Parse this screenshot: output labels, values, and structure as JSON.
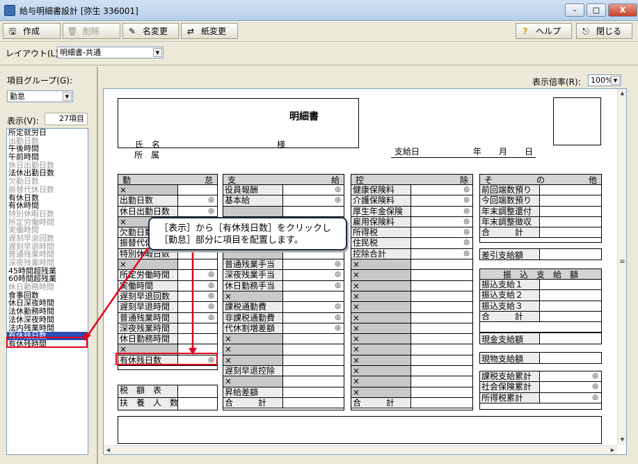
{
  "window": {
    "title": "給与明細書設計 [弥生 336001]",
    "min": "–",
    "max": "□",
    "close": "X"
  },
  "toolbar": {
    "create": "作成",
    "delete": "削除",
    "rename": "名変更",
    "paper": "紙変更",
    "help": "ヘルプ",
    "close": "閉じる"
  },
  "layout": {
    "label": "レイアウト(L):",
    "value": "明細書-共通"
  },
  "group": {
    "label": "項目グループ(G):",
    "value": "勤怠"
  },
  "display": {
    "label": "表示(V):",
    "count": "27項目"
  },
  "zoom": {
    "label": "表示倍率(R):",
    "value": "100%"
  },
  "items": [
    {
      "t": "所定就労日",
      "d": false
    },
    {
      "t": "出勤日数",
      "d": true
    },
    {
      "t": "午後時間",
      "d": false
    },
    {
      "t": "午前時間",
      "d": false
    },
    {
      "t": "休日出勤日数",
      "d": true
    },
    {
      "t": "法休出勤日数",
      "d": false
    },
    {
      "t": "欠勤日数",
      "d": true
    },
    {
      "t": "振替代休日数",
      "d": true
    },
    {
      "t": "有休日数",
      "d": false
    },
    {
      "t": "有休時間",
      "d": false
    },
    {
      "t": "特別休暇日数",
      "d": true
    },
    {
      "t": "所定労働時間",
      "d": true
    },
    {
      "t": "実働時間",
      "d": true
    },
    {
      "t": "遅刻早退回数",
      "d": true
    },
    {
      "t": "遅刻早退時間",
      "d": true
    },
    {
      "t": "普通残業時間",
      "d": true
    },
    {
      "t": "深夜残業時間",
      "d": true
    },
    {
      "t": "45時間超残業",
      "d": false
    },
    {
      "t": "60時間超残業",
      "d": false
    },
    {
      "t": "休日勤務時間",
      "d": true
    },
    {
      "t": "食事回数",
      "d": false
    },
    {
      "t": "休日深夜時間",
      "d": false
    },
    {
      "t": "法休勤務時間",
      "d": false
    },
    {
      "t": "法休深夜時間",
      "d": false
    },
    {
      "t": "法内残業時間",
      "d": false
    },
    {
      "t": "有休残日数",
      "d": false
    },
    {
      "t": "有休残時間",
      "d": false
    }
  ],
  "selected_item": "有休残日数",
  "sheet": {
    "title": "明細書",
    "name_label": "氏　名",
    "dept_label": "所　属",
    "sama": "様",
    "payday": "支給日",
    "year": "年",
    "month": "月",
    "day": "日",
    "kintai_header": [
      "勤",
      "怠"
    ],
    "shikyu_header": [
      "支",
      "給"
    ],
    "kojo_header": [
      "控",
      "除"
    ],
    "sonota_header": [
      "そ",
      "の",
      "他"
    ],
    "kintai": [
      "×",
      "出勤日数",
      "休日出勤日数",
      "×",
      "欠勤日数",
      "振替代休日数",
      "特別休暇日数",
      "×",
      "所定労働時間",
      "実働時間",
      "遅刻早退回数",
      "遅刻早退時間",
      "普通残業時間",
      "深夜残業時間",
      "休日勤務時間",
      "×",
      "有休残日数"
    ],
    "shikyu": [
      "役員報酬",
      "基本給",
      "",
      "",
      "",
      "",
      "",
      "普通残業手当",
      "深夜残業手当",
      "休日勤務手当",
      "×",
      "課税通勤費",
      "非課税通勤費",
      "代休割増差額",
      "×",
      "×",
      "×",
      "遅刻早退控除",
      "×",
      "昇給差額",
      "合　　　計"
    ],
    "kojo": [
      "健康保険料",
      "介護保険料",
      "厚生年金保険",
      "雇用保険料",
      "所得税",
      "住民税",
      "控除合計",
      "×",
      "×",
      "×",
      "×",
      "×",
      "×",
      "×",
      "×",
      "×",
      "×",
      "×",
      "×",
      "×",
      "合　　　計"
    ],
    "sonota": [
      "前回端数預り",
      "今回端数預り",
      "年末調整還付",
      "年末調整徴収",
      "合　　　計"
    ],
    "sashihiki": "差引支給額",
    "furikomi": "振　込　支　給　額",
    "furikomi_rows": [
      "振込支給１",
      "振込支給２",
      "振込支給３",
      "合　　　計"
    ],
    "genkin": "現金支給額",
    "genbutsu": "現物支給額",
    "ruikei": [
      "課税支給累計",
      "社会保険累計",
      "所得税累計"
    ],
    "zeigaku": "税　額　表",
    "fuyou": "扶　養　人　数",
    "mark": "◎"
  },
  "callout": {
    "line1": "［表示］から［有休残日数］をクリックし",
    "line2": "［勤怠］部分に項目を配置します。"
  },
  "colors": {
    "accent": "#e0001b",
    "selection": "#2a4db6"
  }
}
